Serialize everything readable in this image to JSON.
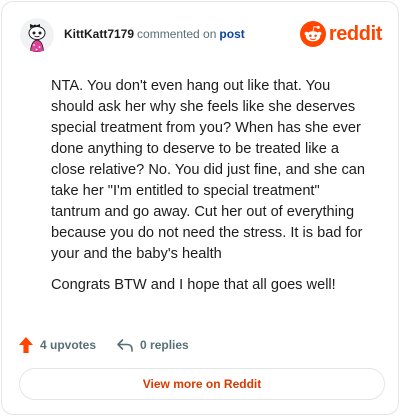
{
  "header": {
    "username": "KittKatt7179",
    "verb": "commented on",
    "post_link": "post",
    "brand": "reddit"
  },
  "comment": {
    "paragraphs": [
      "NTA. You don't even hang out like that. You should ask her why she feels like she deserves special treatment from you? When has she ever done anything to deserve to be treated like a close relative? No. You did just fine, and she can take her \"I'm entitled to special treatment\" tantrum and go away. Cut her out of everything because you do not need the stress. It is bad for your and the baby's health",
      "Congrats BTW and I hope that all goes well!"
    ]
  },
  "actions": {
    "upvotes": "4 upvotes",
    "replies": "0 replies"
  },
  "footer": {
    "view_more": "View more on Reddit"
  },
  "colors": {
    "brand": "#ff4500",
    "upvote": "#ff4500",
    "link": "#0a449b",
    "view_more": "#d93a00",
    "muted": "#576f76"
  },
  "icons": {
    "avatar": "snoo-avatar",
    "brand": "reddit-logo",
    "upvote": "upvote-arrow-icon",
    "reply": "reply-arrow-icon"
  }
}
